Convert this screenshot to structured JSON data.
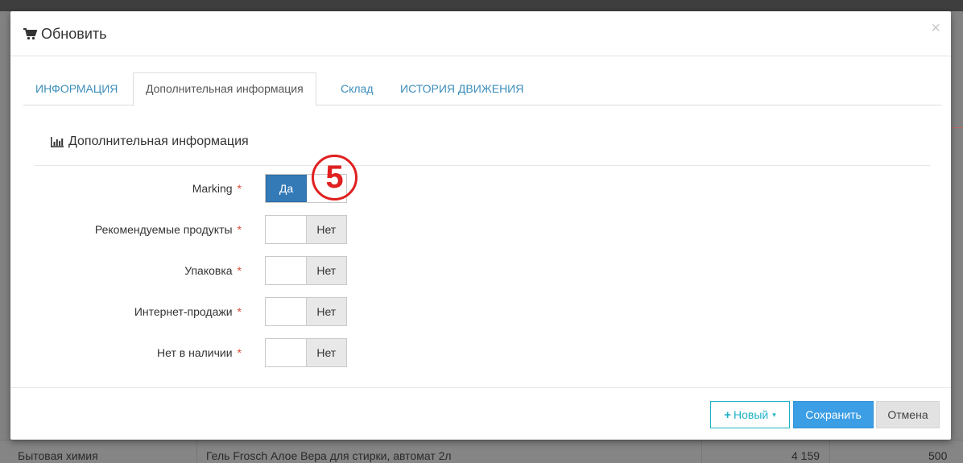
{
  "modal": {
    "title": "Обновить",
    "title_icon": "shopping-cart-icon",
    "close": "×"
  },
  "tabs": [
    {
      "label": "ИНФОРМАЦИЯ",
      "active": false
    },
    {
      "label": "Дополнительная информация",
      "active": true
    },
    {
      "label": "Склад",
      "active": false
    },
    {
      "label": "ИСТОРИЯ ДВИЖЕНИЯ",
      "active": false
    }
  ],
  "section": {
    "title": "Дополнительная информация",
    "icon": "bar-chart-icon"
  },
  "fields": [
    {
      "label": "Marking",
      "required": "*",
      "state": "Да",
      "value": true
    },
    {
      "label": "Рекомендуемые продукты",
      "required": "*",
      "state": "Нет",
      "value": false
    },
    {
      "label": "Упаковка",
      "required": "*",
      "state": "Нет",
      "value": false
    },
    {
      "label": "Интернет-продажи",
      "required": "*",
      "state": "Нет",
      "value": false
    },
    {
      "label": "Нет в наличии",
      "required": "*",
      "state": "Нет",
      "value": false
    }
  ],
  "annotation": {
    "step_marker": "5"
  },
  "footer": {
    "new_label": "Новый",
    "save_label": "Сохранить",
    "cancel_label": "Отмена"
  },
  "background": {
    "row": {
      "category": "Бытовая химия",
      "product": "Гель Frosch Алое Вера для стирки, автомат 2л",
      "value1": "4 159",
      "value2": "500"
    }
  },
  "colors": {
    "primary": "#337ab7",
    "link": "#3c8dbc",
    "save": "#3c9ee5",
    "new_outline": "#1eb1c6",
    "required": "#dd4b39",
    "annotation": "#e02020"
  }
}
